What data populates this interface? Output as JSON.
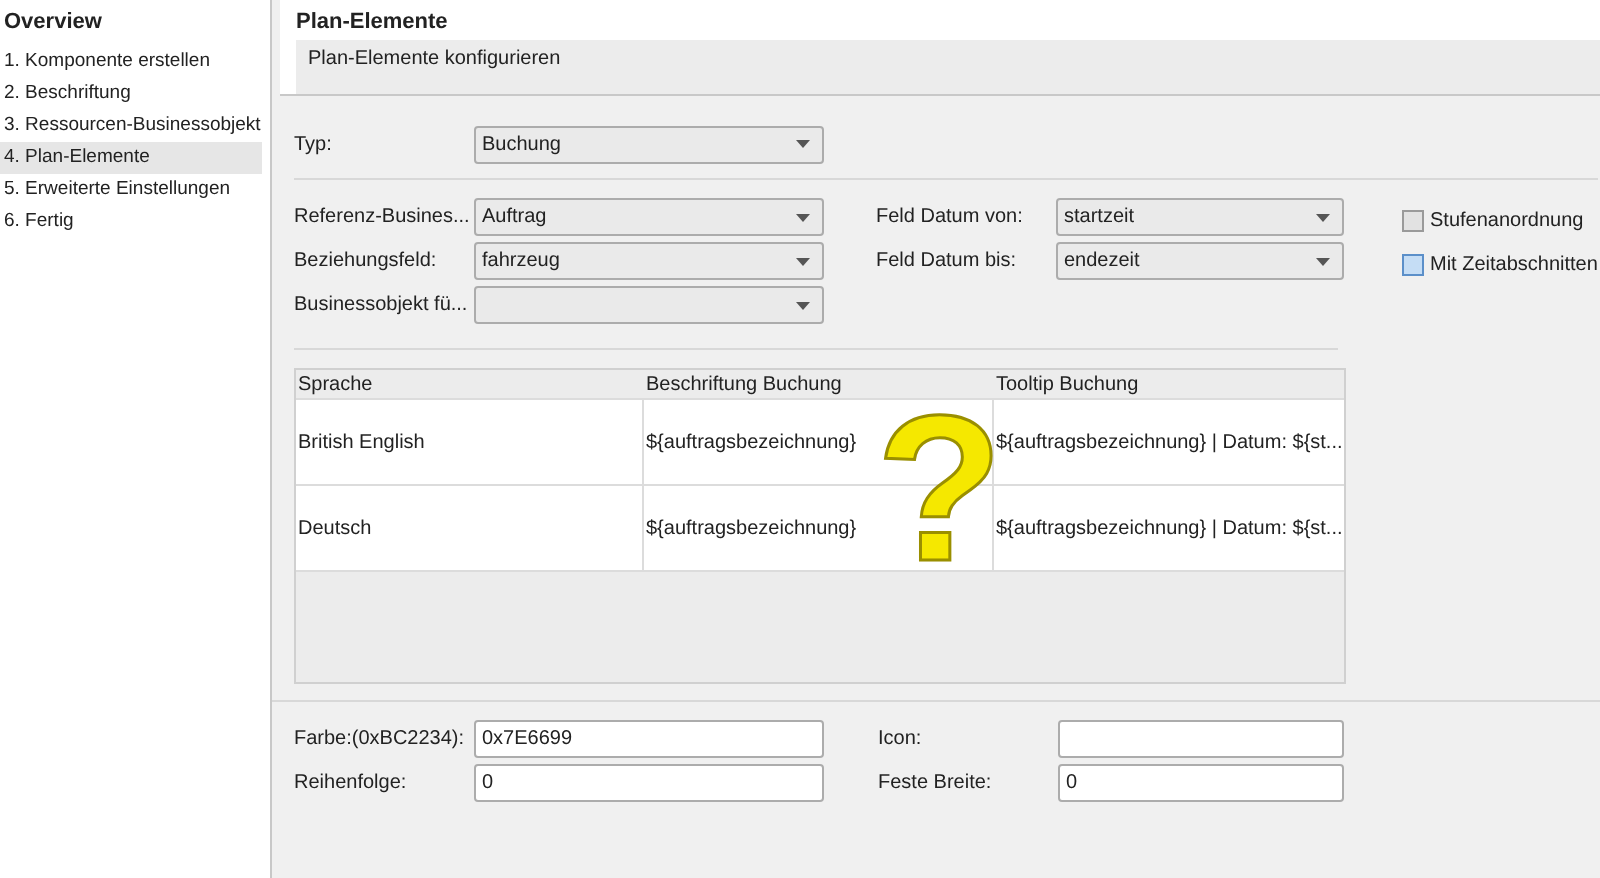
{
  "sidebar": {
    "title": "Overview",
    "items": [
      {
        "label": "1. Komponente erstellen",
        "selected": false
      },
      {
        "label": "2. Beschriftung",
        "selected": false
      },
      {
        "label": "3. Ressourcen-Businessobjekt",
        "selected": false
      },
      {
        "label": "4. Plan-Elemente",
        "selected": true
      },
      {
        "label": "5. Erweiterte Einstellungen",
        "selected": false
      },
      {
        "label": "6. Fertig",
        "selected": false
      }
    ]
  },
  "header": {
    "title": "Plan-Elemente",
    "description": "Plan-Elemente konfigurieren"
  },
  "typ": {
    "label": "Typ:",
    "value": "Buchung"
  },
  "left_fields": [
    {
      "label": "Referenz-Busines...",
      "value": "Auftrag"
    },
    {
      "label": "Beziehungsfeld:",
      "value": "fahrzeug"
    },
    {
      "label": "Businessobjekt fü..."
    }
  ],
  "right_fields": [
    {
      "label": "Feld Datum von:",
      "value": "startzeit"
    },
    {
      "label": "Feld Datum bis:",
      "value": "endezeit"
    }
  ],
  "checkboxes": [
    {
      "label": "Stufenanordnung",
      "checked": false,
      "hovered": false
    },
    {
      "label": "Mit Zeitabschnitten",
      "checked": false,
      "hovered": true
    }
  ],
  "table": {
    "columns": [
      "Sprache",
      "Beschriftung Buchung",
      "Tooltip Buchung"
    ],
    "rows": [
      [
        "British English",
        "${auftragsbezeichnung}",
        "${auftragsbezeichnung} | Datum: ${st..."
      ],
      [
        "Deutsch",
        "${auftragsbezeichnung}",
        "${auftragsbezeichnung} | Datum: ${st..."
      ]
    ]
  },
  "annotation": "?",
  "bottom_fields": [
    {
      "label": "Farbe:(0xBC2234):",
      "value": "0x7E6699"
    },
    {
      "label": "Icon:"
    },
    {
      "label": "Reihenfolge:",
      "value": "0"
    },
    {
      "label": "Feste Breite:",
      "value": "0"
    }
  ]
}
